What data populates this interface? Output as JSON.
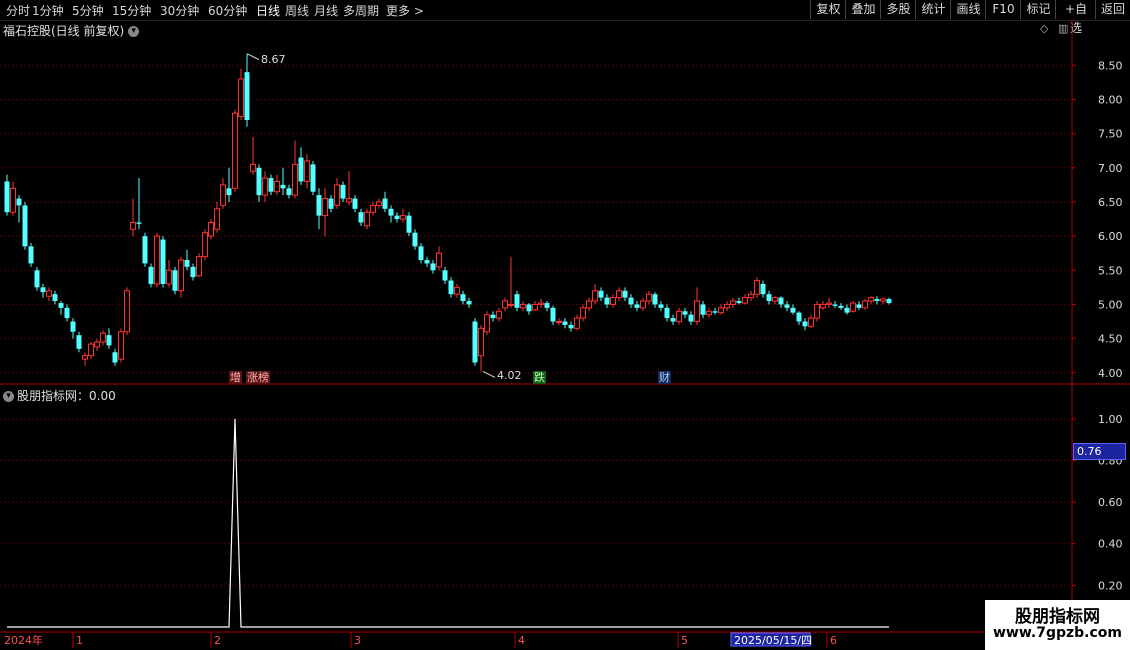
{
  "toolbar": {
    "timeframes": [
      "分时",
      "1分钟",
      "5分钟",
      "15分钟",
      "30分钟",
      "60分钟",
      "日线",
      "周线",
      "月线",
      "多周期",
      "更多 >"
    ],
    "active": "日线",
    "right_buttons": [
      "复权",
      "叠加",
      "多股",
      "统计",
      "画线",
      "F10",
      "标记",
      "+自选",
      "返回"
    ]
  },
  "chart_title": "福石控股(日线 前复权)",
  "high_label": "8.67",
  "low_label": "4.02",
  "tags": {
    "zeng": "增",
    "zhangbang": "涨榜",
    "die": "跌",
    "cai": "财"
  },
  "price_axis": [
    "8.50",
    "8.00",
    "7.50",
    "7.00",
    "6.50",
    "6.00",
    "5.50",
    "5.00",
    "4.50",
    "4.00"
  ],
  "indicator_title": "股朋指标网：0.00",
  "indicator_axis": [
    "1.00",
    "0.80",
    "0.60",
    "0.40",
    "0.20"
  ],
  "cursor_value": "0.76",
  "date_axis": {
    "year": "2024年",
    "months": [
      "1",
      "2",
      "3",
      "4",
      "5",
      "6"
    ],
    "highlight": "2025/05/15/四"
  },
  "watermark": {
    "line1": "股朋指标网",
    "line2": "www.7gpzb.com"
  },
  "colors": {
    "up": "#ff3232",
    "down": "#54ffff",
    "grid": "#8b0000",
    "axis": "#b00000"
  },
  "chart_data": {
    "type": "candlestick",
    "ylim": [
      3.85,
      8.9
    ],
    "candles": [
      [
        6.8,
        6.35,
        6.9,
        6.3
      ],
      [
        6.35,
        6.7,
        6.8,
        6.3
      ],
      [
        6.55,
        6.45,
        6.6,
        6.2
      ],
      [
        6.45,
        5.85,
        6.5,
        5.8
      ],
      [
        5.85,
        5.6,
        5.9,
        5.55
      ],
      [
        5.5,
        5.25,
        5.55,
        5.2
      ],
      [
        5.25,
        5.18,
        5.3,
        5.1
      ],
      [
        5.12,
        5.2,
        5.25,
        5.05
      ],
      [
        5.15,
        5.05,
        5.2,
        5.0
      ],
      [
        5.02,
        4.95,
        5.05,
        4.85
      ],
      [
        4.95,
        4.8,
        5.0,
        4.75
      ],
      [
        4.75,
        4.6,
        4.8,
        4.5
      ],
      [
        4.55,
        4.35,
        4.6,
        4.3
      ],
      [
        4.2,
        4.25,
        4.3,
        4.1
      ],
      [
        4.25,
        4.42,
        4.45,
        4.2
      ],
      [
        4.38,
        4.45,
        4.5,
        4.32
      ],
      [
        4.45,
        4.58,
        4.62,
        4.4
      ],
      [
        4.55,
        4.4,
        4.65,
        4.35
      ],
      [
        4.3,
        4.15,
        4.35,
        4.1
      ],
      [
        4.2,
        4.6,
        4.65,
        4.15
      ],
      [
        4.6,
        5.2,
        5.25,
        4.55
      ],
      [
        6.1,
        6.2,
        6.55,
        6.0
      ],
      [
        6.2,
        6.18,
        6.85,
        6.1
      ],
      [
        6.0,
        5.6,
        6.05,
        5.55
      ],
      [
        5.55,
        5.3,
        5.6,
        5.25
      ],
      [
        5.3,
        6.0,
        6.05,
        5.25
      ],
      [
        5.95,
        5.3,
        6.0,
        5.25
      ],
      [
        5.3,
        5.5,
        5.65,
        5.25
      ],
      [
        5.5,
        5.2,
        5.55,
        5.15
      ],
      [
        5.2,
        5.65,
        5.7,
        5.1
      ],
      [
        5.65,
        5.55,
        5.8,
        5.5
      ],
      [
        5.55,
        5.4,
        5.6,
        5.35
      ],
      [
        5.42,
        5.7,
        5.75,
        5.4
      ],
      [
        5.7,
        6.05,
        6.1,
        5.65
      ],
      [
        6.0,
        6.2,
        6.25,
        5.95
      ],
      [
        6.1,
        6.4,
        6.5,
        6.05
      ],
      [
        6.45,
        6.75,
        6.85,
        6.4
      ],
      [
        6.7,
        6.6,
        7.0,
        6.5
      ],
      [
        6.7,
        7.8,
        7.85,
        6.65
      ],
      [
        7.75,
        8.3,
        8.45,
        7.7
      ],
      [
        8.4,
        7.7,
        8.67,
        7.6
      ],
      [
        6.95,
        7.05,
        7.45,
        6.9
      ],
      [
        7.0,
        6.6,
        7.05,
        6.5
      ],
      [
        6.6,
        6.85,
        6.95,
        6.5
      ],
      [
        6.85,
        6.65,
        6.9,
        6.6
      ],
      [
        6.65,
        6.8,
        6.9,
        6.6
      ],
      [
        6.75,
        6.7,
        7.0,
        6.6
      ],
      [
        6.7,
        6.6,
        6.75,
        6.55
      ],
      [
        6.6,
        7.05,
        7.4,
        6.55
      ],
      [
        7.15,
        6.8,
        7.3,
        6.75
      ],
      [
        6.8,
        7.1,
        7.2,
        6.7
      ],
      [
        7.05,
        6.65,
        7.1,
        6.6
      ],
      [
        6.6,
        6.3,
        6.7,
        6.1
      ],
      [
        6.3,
        6.55,
        6.7,
        6.0
      ],
      [
        6.55,
        6.4,
        6.6,
        6.35
      ],
      [
        6.45,
        6.75,
        6.85,
        6.4
      ],
      [
        6.75,
        6.55,
        6.8,
        6.5
      ],
      [
        6.5,
        6.55,
        6.95,
        6.45
      ],
      [
        6.55,
        6.4,
        6.6,
        6.35
      ],
      [
        6.35,
        6.2,
        6.4,
        6.15
      ],
      [
        6.15,
        6.35,
        6.4,
        6.1
      ],
      [
        6.35,
        6.45,
        6.5,
        6.3
      ],
      [
        6.45,
        6.5,
        6.55,
        6.4
      ],
      [
        6.55,
        6.4,
        6.65,
        6.35
      ],
      [
        6.4,
        6.3,
        6.45,
        6.2
      ],
      [
        6.3,
        6.25,
        6.35,
        6.2
      ],
      [
        6.25,
        6.3,
        6.4,
        6.2
      ],
      [
        6.3,
        6.05,
        6.35,
        6.0
      ],
      [
        6.05,
        5.85,
        6.1,
        5.8
      ],
      [
        5.85,
        5.65,
        5.9,
        5.6
      ],
      [
        5.65,
        5.6,
        5.7,
        5.55
      ],
      [
        5.6,
        5.5,
        5.65,
        5.45
      ],
      [
        5.55,
        5.75,
        5.85,
        5.5
      ],
      [
        5.5,
        5.35,
        5.55,
        5.3
      ],
      [
        5.35,
        5.15,
        5.4,
        5.1
      ],
      [
        5.15,
        5.25,
        5.3,
        5.1
      ],
      [
        5.15,
        5.05,
        5.2,
        5.0
      ],
      [
        5.05,
        5.0,
        5.1,
        4.95
      ],
      [
        4.75,
        4.15,
        4.8,
        4.1
      ],
      [
        4.25,
        4.65,
        4.7,
        4.02
      ],
      [
        4.6,
        4.85,
        4.9,
        4.55
      ],
      [
        4.85,
        4.8,
        4.9,
        4.75
      ],
      [
        4.8,
        4.9,
        4.95,
        4.75
      ],
      [
        4.95,
        5.05,
        5.1,
        4.9
      ],
      [
        5.0,
        5.0,
        5.7,
        4.95
      ],
      [
        5.15,
        4.95,
        5.2,
        4.9
      ],
      [
        4.95,
        5.0,
        5.05,
        4.9
      ],
      [
        5.0,
        4.9,
        5.02,
        4.85
      ],
      [
        4.92,
        5.0,
        5.05,
        4.9
      ],
      [
        5.0,
        5.02,
        5.08,
        4.95
      ],
      [
        5.02,
        4.95,
        5.05,
        4.9
      ],
      [
        4.95,
        4.75,
        4.98,
        4.7
      ],
      [
        4.75,
        4.75,
        4.8,
        4.7
      ],
      [
        4.75,
        4.7,
        4.8,
        4.65
      ],
      [
        4.7,
        4.65,
        4.75,
        4.6
      ],
      [
        4.65,
        4.8,
        4.85,
        4.62
      ],
      [
        4.8,
        4.95,
        5.0,
        4.75
      ],
      [
        4.95,
        5.05,
        5.1,
        4.9
      ],
      [
        5.05,
        5.2,
        5.3,
        5.0
      ],
      [
        5.2,
        5.1,
        5.25,
        5.05
      ],
      [
        5.1,
        5.0,
        5.15,
        4.95
      ],
      [
        5.0,
        5.1,
        5.15,
        4.95
      ],
      [
        5.1,
        5.2,
        5.25,
        5.05
      ],
      [
        5.2,
        5.1,
        5.25,
        5.05
      ],
      [
        5.1,
        5.0,
        5.15,
        4.95
      ],
      [
        5.0,
        4.95,
        5.05,
        4.9
      ],
      [
        4.95,
        5.05,
        5.1,
        4.9
      ],
      [
        5.05,
        5.15,
        5.2,
        5.0
      ],
      [
        5.15,
        5.0,
        5.18,
        4.95
      ],
      [
        5.0,
        4.95,
        5.05,
        4.9
      ],
      [
        4.95,
        4.8,
        5.0,
        4.75
      ],
      [
        4.8,
        4.75,
        4.85,
        4.7
      ],
      [
        4.75,
        4.9,
        4.95,
        4.7
      ],
      [
        4.9,
        4.85,
        4.95,
        4.8
      ],
      [
        4.85,
        4.75,
        4.9,
        4.7
      ],
      [
        4.75,
        5.05,
        5.25,
        4.7
      ],
      [
        5.0,
        4.85,
        5.05,
        4.8
      ],
      [
        4.85,
        4.9,
        4.95,
        4.8
      ],
      [
        4.9,
        4.88,
        4.95,
        4.85
      ],
      [
        4.88,
        4.95,
        5.0,
        4.85
      ],
      [
        4.95,
        5.0,
        5.05,
        4.9
      ],
      [
        5.0,
        5.05,
        5.1,
        4.95
      ],
      [
        5.05,
        5.02,
        5.1,
        5.0
      ],
      [
        5.02,
        5.1,
        5.15,
        5.0
      ],
      [
        5.1,
        5.15,
        5.2,
        5.05
      ],
      [
        5.15,
        5.35,
        5.4,
        5.1
      ],
      [
        5.3,
        5.15,
        5.35,
        5.1
      ],
      [
        5.15,
        5.05,
        5.2,
        5.0
      ],
      [
        5.05,
        5.1,
        5.12,
        5.0
      ],
      [
        5.1,
        5.0,
        5.12,
        4.95
      ],
      [
        5.0,
        4.95,
        5.05,
        4.9
      ],
      [
        4.95,
        4.88,
        5.0,
        4.85
      ],
      [
        4.88,
        4.75,
        4.9,
        4.7
      ],
      [
        4.75,
        4.68,
        4.8,
        4.62
      ],
      [
        4.68,
        4.8,
        4.85,
        4.65
      ],
      [
        4.8,
        5.0,
        5.05,
        4.75
      ],
      [
        4.95,
        5.0,
        5.05,
        4.92
      ],
      [
        5.0,
        5.02,
        5.1,
        4.95
      ],
      [
        5.0,
        4.98,
        5.05,
        4.95
      ],
      [
        4.98,
        4.95,
        5.02,
        4.92
      ],
      [
        4.95,
        4.88,
        5.0,
        4.85
      ],
      [
        4.9,
        5.02,
        5.05,
        4.88
      ],
      [
        5.0,
        4.95,
        5.05,
        4.92
      ],
      [
        4.95,
        5.05,
        5.08,
        4.92
      ],
      [
        5.05,
        5.1,
        5.12,
        5.0
      ],
      [
        5.08,
        5.05,
        5.12,
        5.0
      ],
      [
        5.05,
        5.08,
        5.1,
        5.0
      ],
      [
        5.08,
        5.02,
        5.1,
        5.0
      ]
    ],
    "indicator": {
      "ylim": [
        0,
        1.1
      ],
      "peak_index": 38,
      "peak_value": 1.0,
      "base_value": 0.0
    }
  }
}
